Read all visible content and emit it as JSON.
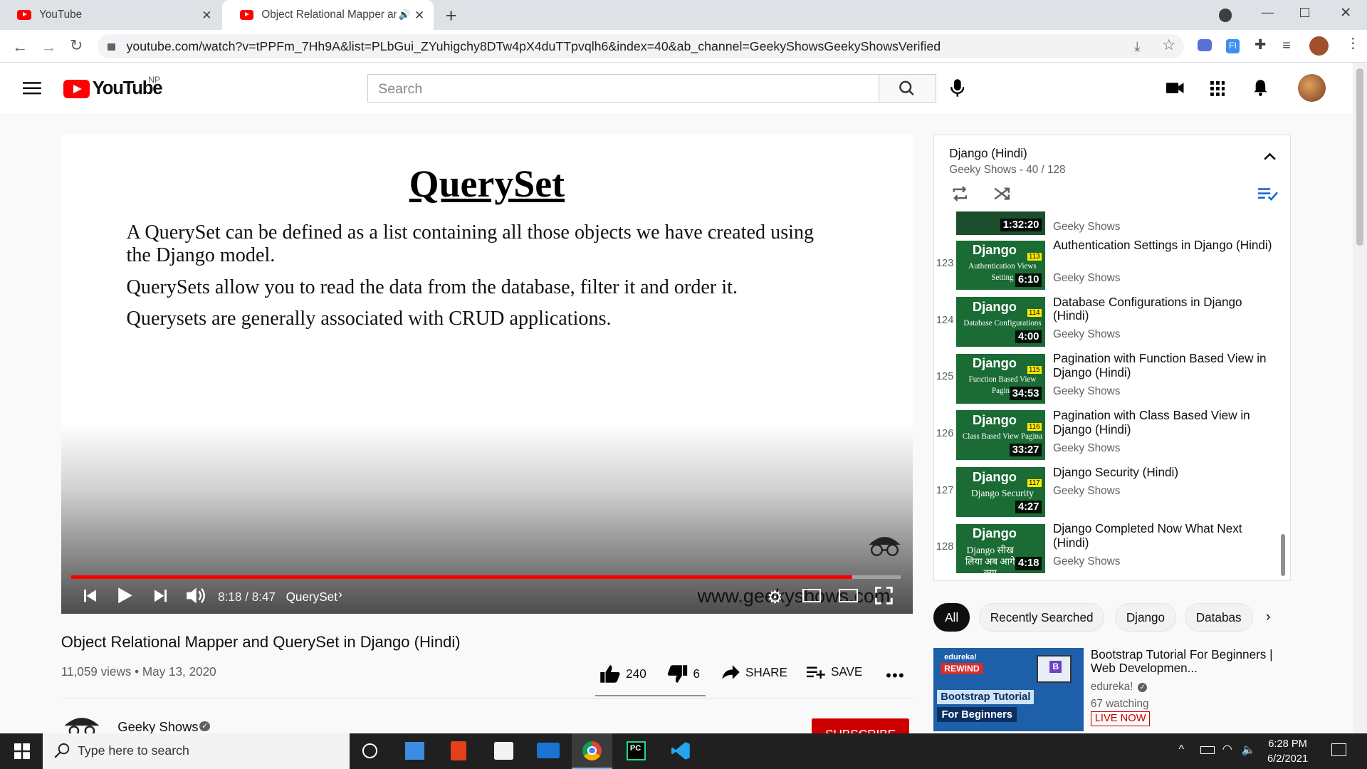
{
  "browser": {
    "tabs": [
      {
        "title": "YouTube"
      },
      {
        "title": "Object Relational Mapper an"
      }
    ],
    "url": "youtube.com/watch?v=tPPFm_7Hh9A&list=PLbGui_ZYuhigchy8DTw4pX4duTTpvqlh6&index=40&ab_channel=GeekyShowsGeekyShowsVerified"
  },
  "header": {
    "logo_text": "YouTube",
    "region": "NP",
    "search_placeholder": "Search"
  },
  "video": {
    "slide_title": "QuerySet",
    "slide_lines": [
      "A QuerySet can be defined as a list containing all those objects we have created using the Django model.",
      "QuerySets allow you to read the data from the database, filter it and order it.",
      "Querysets are generally associated with CRUD applications."
    ],
    "time": "8:18 / 8:47",
    "chapter": "QuerySet",
    "watermark": "www.geekyshows.com",
    "progress": 0.942
  },
  "meta": {
    "title": "Object Relational Mapper and QuerySet in Django (Hindi)",
    "views": "11,059 views • May 13, 2020",
    "likes": "240",
    "dislikes": "6",
    "share": "SHARE",
    "save": "SAVE",
    "channel": "Geeky Shows",
    "subscribe": "SUBSCRIBE"
  },
  "playlist": {
    "title": "Django (Hindi)",
    "subtitle": "Geeky Shows - 40 / 128",
    "partial": {
      "dur": "1:32:20",
      "channel": "Geeky Shows"
    },
    "items": [
      {
        "num": "123",
        "title": "Authentication Settings in Django (Hindi)",
        "channel": "Geeky Shows",
        "dur": "6:10",
        "badge": "113",
        "sub": "Authentication Views Setting"
      },
      {
        "num": "124",
        "title": "Database Configurations in Django (Hindi)",
        "channel": "Geeky Shows",
        "dur": "4:00",
        "badge": "114",
        "sub": "Database Configurations"
      },
      {
        "num": "125",
        "title": "Pagination with Function Based View in Django (Hindi)",
        "channel": "Geeky Shows",
        "dur": "34:53",
        "badge": "115",
        "sub": "Function Based View Pagina"
      },
      {
        "num": "126",
        "title": "Pagination with Class Based View in Django (Hindi)",
        "channel": "Geeky Shows",
        "dur": "33:27",
        "badge": "116",
        "sub": "Class Based View Pagina"
      },
      {
        "num": "127",
        "title": "Django Security (Hindi)",
        "channel": "Geeky Shows",
        "dur": "4:27",
        "badge": "117",
        "sub": "Django Security"
      },
      {
        "num": "128",
        "title": "Django Completed Now What Next (Hindi)",
        "channel": "Geeky Shows",
        "dur": "4:18",
        "badge": "",
        "sub": "Django सीख लिया अब आगे क्या"
      }
    ]
  },
  "chips": [
    "All",
    "Recently Searched",
    "Django",
    "Databas"
  ],
  "recommended": {
    "title": "Bootstrap Tutorial For Beginners | Web Developmen...",
    "channel": "edureka!",
    "watching": "67 watching",
    "live": "LIVE NOW",
    "thumb_brand": "edureka!",
    "thumb_tag": "REWIND",
    "thumb_line1": "Bootstrap Tutorial",
    "thumb_line2": "For Beginners"
  },
  "taskbar": {
    "search_placeholder": "Type here to search",
    "time": "6:28 PM",
    "date": "6/2/2021"
  },
  "colors": {
    "youtube_red": "#ff0000",
    "playlist_green": "#1a6b34",
    "taskbar": "#202020"
  }
}
